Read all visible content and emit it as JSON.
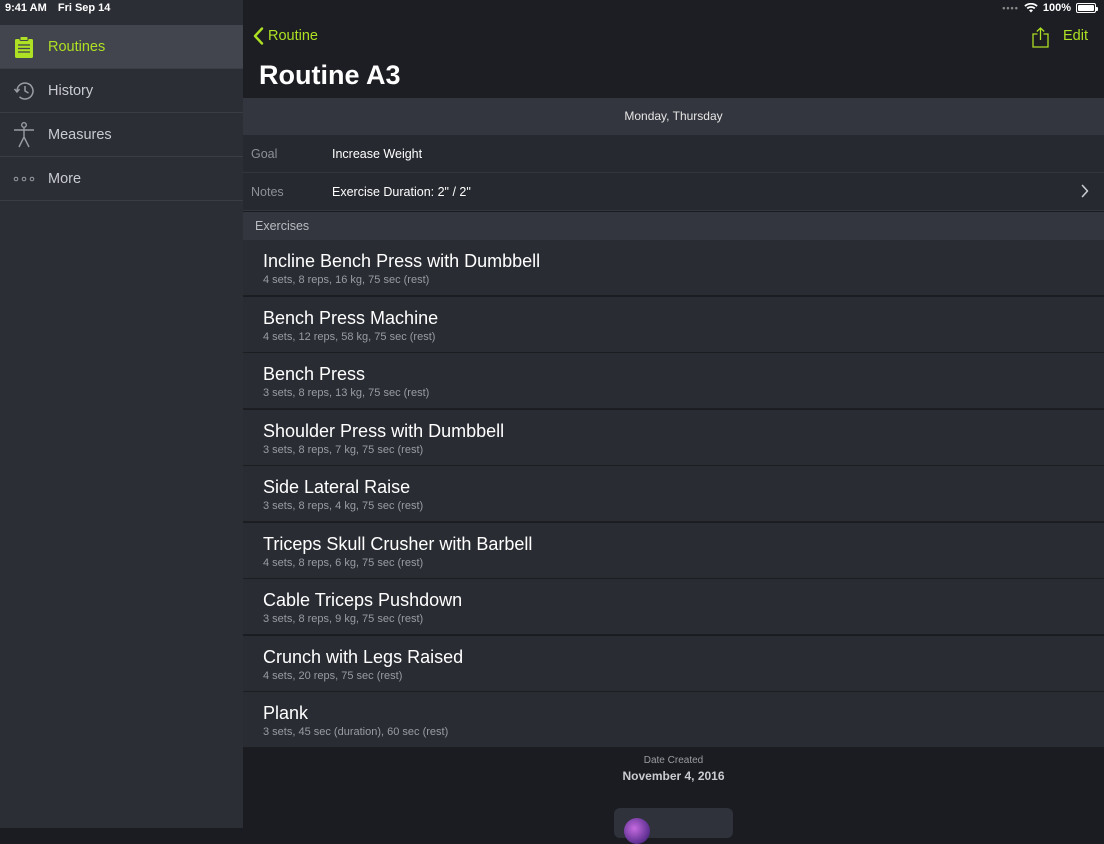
{
  "status": {
    "time": "9:41 AM",
    "date": "Fri Sep 14",
    "battery": "100%"
  },
  "sidebar": {
    "items": [
      {
        "label": "Routines",
        "icon": "clipboard-icon",
        "active": true
      },
      {
        "label": "History",
        "icon": "clock-history-icon",
        "active": false
      },
      {
        "label": "Measures",
        "icon": "body-figure-icon",
        "active": false
      },
      {
        "label": "More",
        "icon": "more-dots-icon",
        "active": false
      }
    ]
  },
  "nav": {
    "back_label": "Routine",
    "edit_label": "Edit",
    "title": "Routine A3"
  },
  "days": "Monday, Thursday",
  "details": {
    "goal_key": "Goal",
    "goal_value": "Increase Weight",
    "notes_key": "Notes",
    "notes_value": "Exercise Duration: 2\" / 2\""
  },
  "exercises_header": "Exercises",
  "exercises": [
    {
      "name": "Incline Bench Press with Dumbbell",
      "detail": "4 sets, 8 reps, 16 kg, 75 sec (rest)"
    },
    {
      "name": "Bench Press Machine",
      "detail": "4 sets, 12 reps, 58 kg, 75 sec (rest)"
    },
    {
      "name": "Bench Press",
      "detail": "3 sets, 8 reps, 13 kg, 75 sec (rest)"
    },
    {
      "name": "Shoulder Press with Dumbbell",
      "detail": "3 sets, 8 reps, 7 kg, 75 sec (rest)"
    },
    {
      "name": "Side Lateral Raise",
      "detail": "3 sets, 8 reps, 4 kg, 75 sec (rest)"
    },
    {
      "name": "Triceps Skull Crusher with Barbell",
      "detail": "4 sets, 8 reps, 6 kg, 75 sec (rest)"
    },
    {
      "name": "Cable Triceps Pushdown",
      "detail": "3 sets, 8 reps, 9 kg, 75 sec (rest)"
    },
    {
      "name": "Crunch with Legs Raised",
      "detail": "4 sets, 20 reps, 75 sec (rest)"
    },
    {
      "name": "Plank",
      "detail": "3 sets, 45 sec (duration), 60 sec (rest)"
    }
  ],
  "created": {
    "label": "Date Created",
    "date": "November 4, 2016"
  },
  "colors": {
    "accent": "#aee023",
    "background": "#1a1c21",
    "sidebar": "#2b2e35",
    "row": "#292c33"
  }
}
